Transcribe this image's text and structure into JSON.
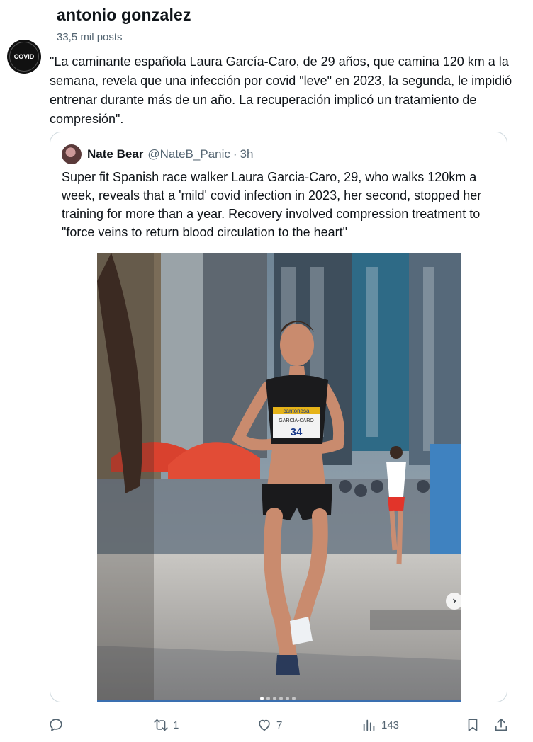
{
  "header": {
    "display_name": "antonio gonzalez",
    "post_count": "33,5 mil posts"
  },
  "tweet": {
    "avatar_label": "COVID",
    "text": "\"La caminante española Laura García-Caro, de 29 años, que camina 120 km a la semana, revela que una infección por covid \"leve\" en 2023, la segunda, le impidió entrenar durante más de un año. La recuperación implicó un tratamiento de compresión\"."
  },
  "quote": {
    "name": "Nate Bear",
    "handle": "@NateB_Panic",
    "separator": "·",
    "time": "3h",
    "text": "Super fit Spanish race walker Laura Garcia-Caro, 29, who walks 120km a week, reveals that a 'mild' covid infection in 2023, her second, stopped her training for more than a year. Recovery involved compression treatment to \"force veins to return blood circulation to the heart\"",
    "media": {
      "bib_sponsor": "cantonesa",
      "bib_name": "GARCIA-CARO",
      "bib_number": "34",
      "carousel_count": 6,
      "carousel_active": 1
    }
  },
  "actions": {
    "reply_count": "",
    "repost_count": "1",
    "like_count": "7",
    "views_count": "143"
  }
}
